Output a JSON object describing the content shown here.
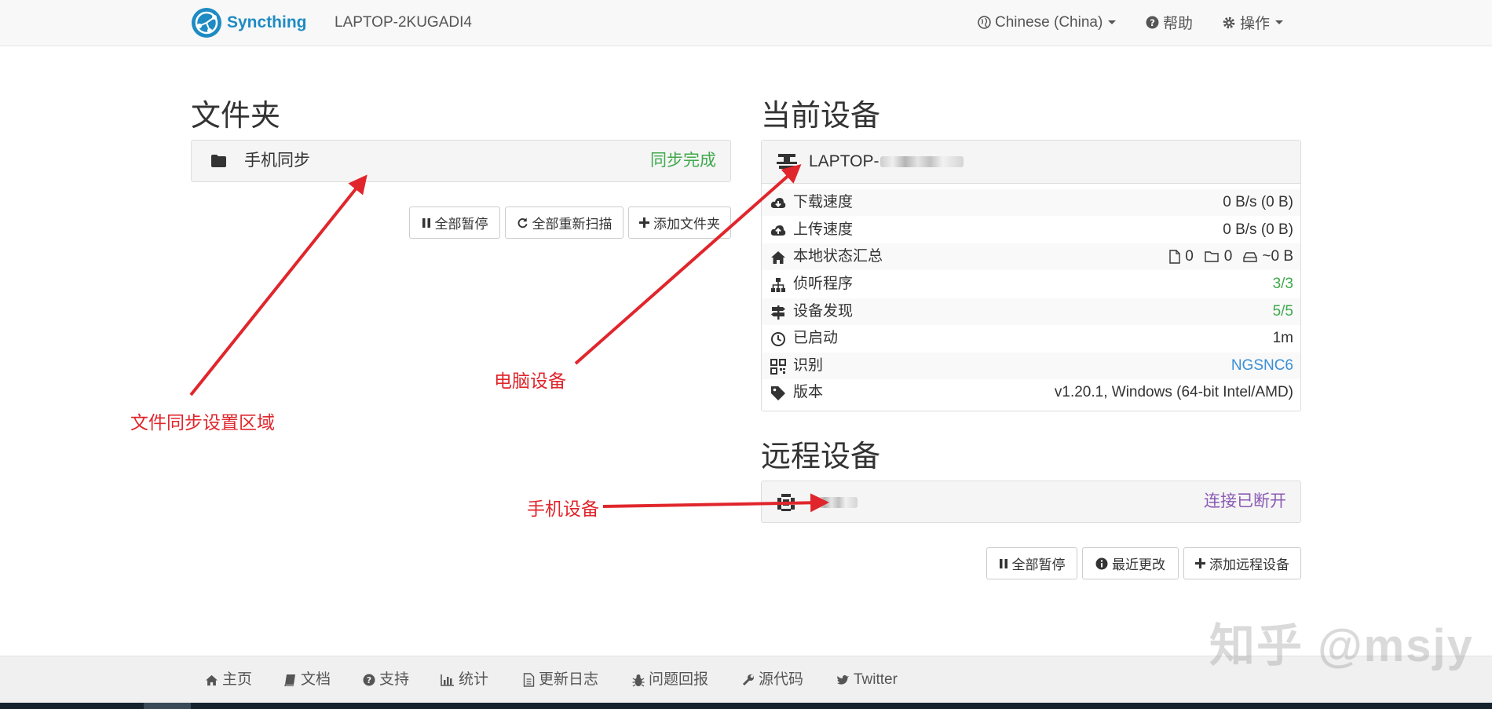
{
  "navbar": {
    "brand": "Syncthing",
    "device_name": "LAPTOP-2KUGADI4",
    "language": "Chinese (China)",
    "help": "帮助",
    "actions": "操作"
  },
  "folders": {
    "title": "文件夹",
    "items": [
      {
        "label": "手机同步",
        "status": "同步完成"
      }
    ],
    "buttons": {
      "pause_all": "全部暂停",
      "rescan_all": "全部重新扫描",
      "add_folder": "添加文件夹"
    }
  },
  "this_device": {
    "title": "当前设备",
    "name_prefix": "LAPTOP-",
    "rows": [
      {
        "icon": "cloud-download-icon",
        "label": "下载速度",
        "value": "0 B/s (0 B)"
      },
      {
        "icon": "cloud-upload-icon",
        "label": "上传速度",
        "value": "0 B/s (0 B)"
      },
      {
        "icon": "home-icon",
        "label": "本地状态汇总",
        "files": "0",
        "dirs": "0",
        "size": "~0 B"
      },
      {
        "icon": "sitemap-icon",
        "label": "侦听程序",
        "value": "3/3"
      },
      {
        "icon": "signpost-icon",
        "label": "设备发现",
        "value": "5/5"
      },
      {
        "icon": "clock-icon",
        "label": "已启动",
        "value": "1m"
      },
      {
        "icon": "qrcode-icon",
        "label": "识别",
        "value": "NGSNC6"
      },
      {
        "icon": "tag-icon",
        "label": "版本",
        "value": "v1.20.1, Windows (64-bit Intel/AMD)"
      }
    ]
  },
  "remote_devices": {
    "title": "远程设备",
    "items": [
      {
        "status": "连接已断开"
      }
    ],
    "buttons": {
      "pause_all": "全部暂停",
      "recent_changes": "最近更改",
      "add_device": "添加远程设备"
    }
  },
  "annotations": {
    "folder_area": "文件同步设置区域",
    "computer_device": "电脑设备",
    "phone_device": "手机设备"
  },
  "footer": {
    "links": [
      "主页",
      "文档",
      "支持",
      "统计",
      "更新日志",
      "问题回报",
      "源代码",
      "Twitter"
    ]
  },
  "watermark": "知乎 @msjy",
  "colors": {
    "brand": "#1e8bc3",
    "success": "#3fa94c",
    "link": "#3a8fd6",
    "disconnected": "#8a5ab5",
    "annotation": "#e0262c"
  }
}
